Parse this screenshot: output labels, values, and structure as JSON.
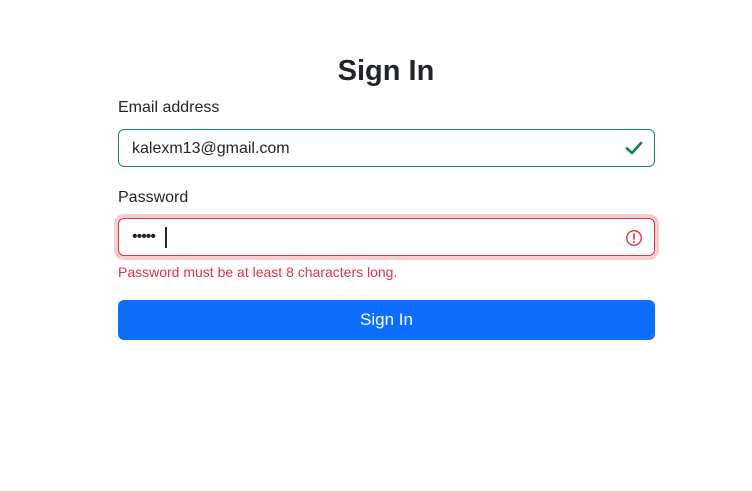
{
  "form": {
    "title": "Sign In",
    "email": {
      "label": "Email address",
      "value": "kalexm13@gmail.com",
      "state": "valid",
      "icon": "check-icon"
    },
    "password": {
      "label": "Password",
      "masked_value": "•••••",
      "state": "invalid",
      "icon": "error-circle-icon",
      "error": "Password must be at least 8 characters long."
    },
    "submit_label": "Sign In"
  },
  "colors": {
    "valid": "#198754",
    "invalid": "#dc3545",
    "primary": "#0d6efd",
    "text": "#212529"
  }
}
